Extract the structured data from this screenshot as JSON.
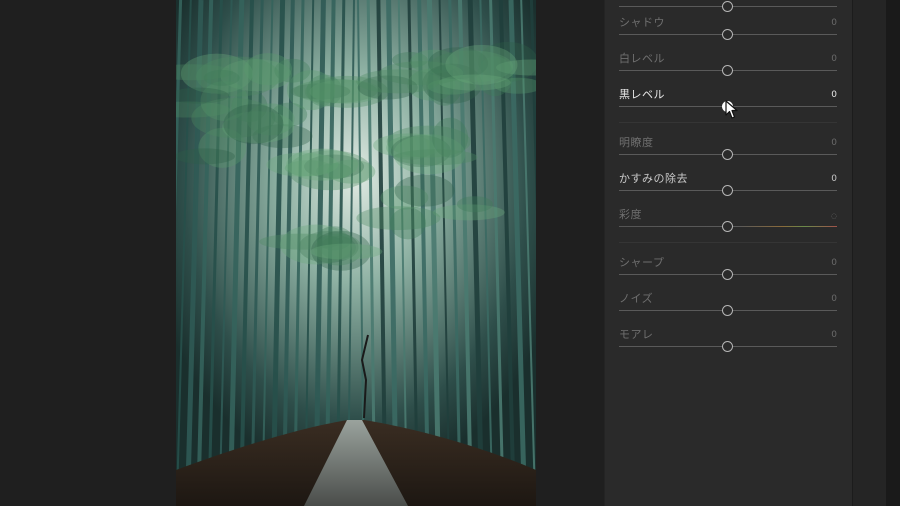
{
  "panel": {
    "sliders": [
      {
        "id": "shadows",
        "label": "シャドウ",
        "value": "0",
        "level": 0.5
      },
      {
        "id": "whites",
        "label": "白レベル",
        "value": "0",
        "level": 0.5
      },
      {
        "id": "blacks",
        "label": "黒レベル",
        "value": "0",
        "level": 0.5
      },
      {
        "id": "clarity",
        "label": "明瞭度",
        "value": "0",
        "level": 0.5
      },
      {
        "id": "dehaze",
        "label": "かすみの除去",
        "value": "0",
        "level": 0.5
      },
      {
        "id": "saturation",
        "label": "彩度",
        "value": "0",
        "level": 0.5
      },
      {
        "id": "sharpen",
        "label": "シャープ",
        "value": "0",
        "level": 0.5
      },
      {
        "id": "noise",
        "label": "ノイズ",
        "value": "0",
        "level": 0.5
      },
      {
        "id": "moire",
        "label": "モアレ",
        "value": "0",
        "level": 0.5
      }
    ]
  },
  "icons": {
    "cursor": "pointer-arrow-icon"
  },
  "colors": {
    "panel_bg": "#2a2a2a",
    "canvas_bg": "#1f1f1f",
    "active_text": "#e6e6e6"
  }
}
